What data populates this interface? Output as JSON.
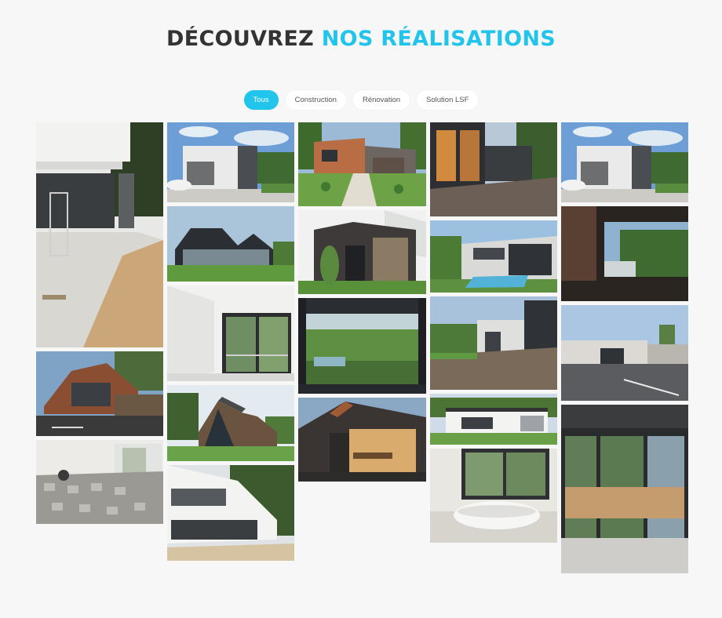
{
  "heading": {
    "part1": "DÉCOUVREZ",
    "part2": "NOS RÉALISATIONS"
  },
  "filters": [
    {
      "label": "Tous",
      "active": true
    },
    {
      "label": "Construction",
      "active": false
    },
    {
      "label": "Rénovation",
      "active": false
    },
    {
      "label": "Solution LSF",
      "active": false
    }
  ],
  "colors": {
    "accent": "#21c4ea",
    "heading_dark": "#333333",
    "background": "#f7f7f7"
  },
  "gallery": [
    {
      "subject": "terrace-under-construction"
    },
    {
      "subject": "modern-grey-house-with-garage"
    },
    {
      "subject": "brick-house-with-garden-path"
    },
    {
      "subject": "wooden-deck-with-large-windows"
    },
    {
      "subject": "modern-grey-house-with-garage"
    },
    {
      "subject": "black-gabled-house"
    },
    {
      "subject": "dark-cube-extension-with-stone"
    },
    {
      "subject": "house-with-pool"
    },
    {
      "subject": "interior-doorway"
    },
    {
      "subject": "white-room-with-bay-window"
    },
    {
      "subject": "dark-pergola-with-pool"
    },
    {
      "subject": "deck-and-modern-house"
    },
    {
      "subject": "street-with-houses"
    },
    {
      "subject": "brick-house-on-street"
    },
    {
      "subject": "glass-gabled-house"
    },
    {
      "subject": "dark-extension-at-night"
    },
    {
      "subject": "flat-roof-house-on-lawn"
    },
    {
      "subject": "room-under-renovation"
    },
    {
      "subject": "bathroom-with-bathtub"
    },
    {
      "subject": "interior-with-large-bay-windows"
    },
    {
      "subject": "white-modern-house"
    }
  ]
}
